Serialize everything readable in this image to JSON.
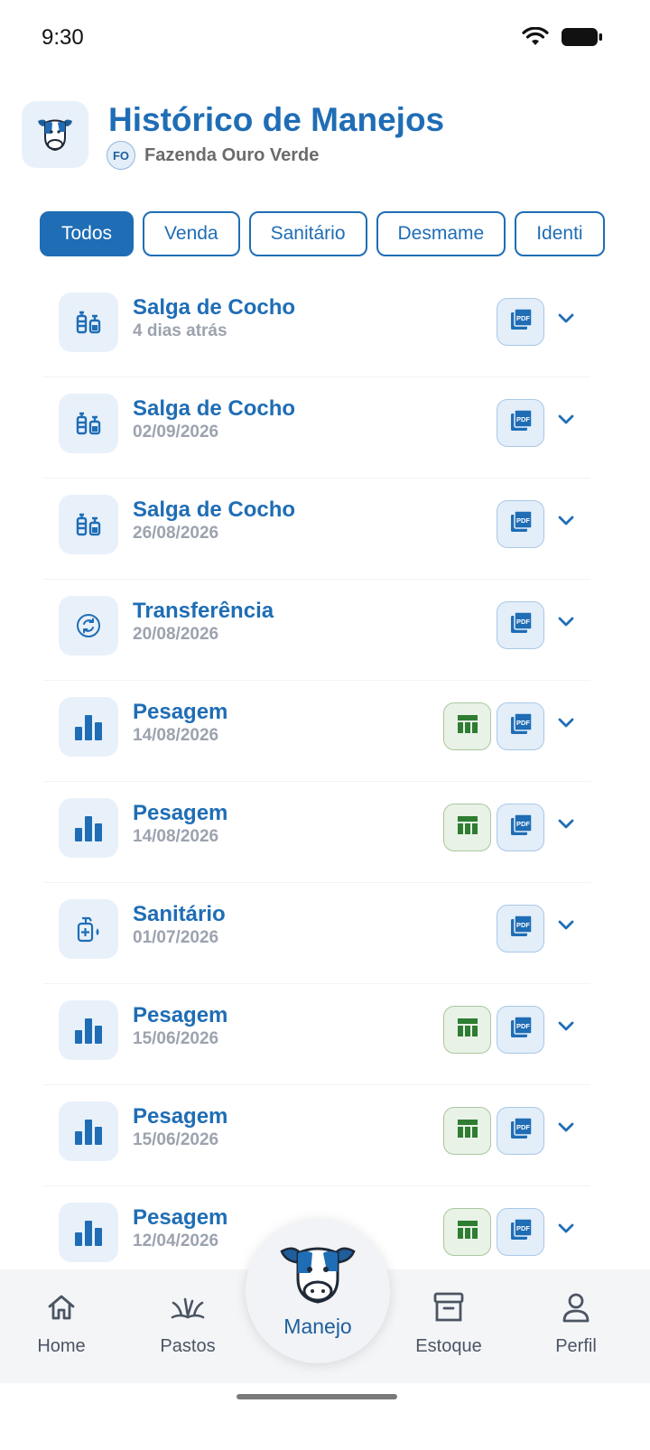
{
  "status_bar": {
    "time": "9:30"
  },
  "header": {
    "title": "Histórico de Manejos",
    "farm_initials": "FO",
    "farm_name": "Fazenda Ouro Verde"
  },
  "filters": [
    {
      "label": "Todos",
      "active": true
    },
    {
      "label": "Venda",
      "active": false
    },
    {
      "label": "Sanitário",
      "active": false
    },
    {
      "label": "Desmame",
      "active": false
    },
    {
      "label": "Identi",
      "active": false
    }
  ],
  "records": [
    {
      "title": "Salga de Cocho",
      "date": "4 dias atrás",
      "icon": "vials-icon",
      "spreadsheet": false
    },
    {
      "title": "Salga de Cocho",
      "date": "02/09/2026",
      "icon": "vials-icon",
      "spreadsheet": false
    },
    {
      "title": "Salga de Cocho",
      "date": "26/08/2026",
      "icon": "vials-icon",
      "spreadsheet": false
    },
    {
      "title": "Transferência",
      "date": "20/08/2026",
      "icon": "transfer-icon",
      "spreadsheet": false
    },
    {
      "title": "Pesagem",
      "date": "14/08/2026",
      "icon": "bar-chart-icon",
      "spreadsheet": true
    },
    {
      "title": "Pesagem",
      "date": "14/08/2026",
      "icon": "bar-chart-icon",
      "spreadsheet": true
    },
    {
      "title": "Sanitário",
      "date": "01/07/2026",
      "icon": "sanitizer-icon",
      "spreadsheet": false
    },
    {
      "title": "Pesagem",
      "date": "15/06/2026",
      "icon": "bar-chart-icon",
      "spreadsheet": true
    },
    {
      "title": "Pesagem",
      "date": "15/06/2026",
      "icon": "bar-chart-icon",
      "spreadsheet": true
    },
    {
      "title": "Pesagem",
      "date": "12/04/2026",
      "icon": "bar-chart-icon",
      "spreadsheet": true
    }
  ],
  "nav": {
    "home": "Home",
    "pastos": "Pastos",
    "manejo": "Manejo",
    "estoque": "Estoque",
    "perfil": "Perfil"
  },
  "colors": {
    "primary": "#1f6db5",
    "sheet_green": "#2e7d32",
    "muted": "#9ca3af"
  }
}
